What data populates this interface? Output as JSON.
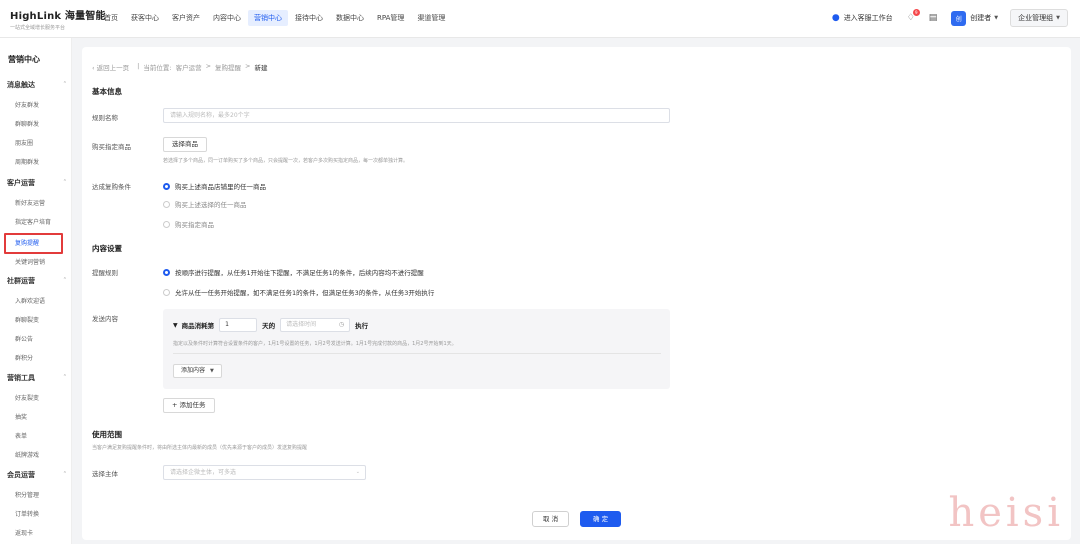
{
  "logo": {
    "title": "HighLink 海量智能",
    "subtitle": "一站式全域增长服务平台"
  },
  "nav": [
    "首页",
    "获客中心",
    "客户资产",
    "内容中心",
    "营销中心",
    "接待中心",
    "数据中心",
    "RPA管理",
    "渠道管理"
  ],
  "nav_active_index": 4,
  "topright": {
    "workspace_link": "进入客服工作台",
    "bell_badge": "9",
    "user_name": "创建者",
    "avatar_text": "创",
    "org_button": "企业管理组"
  },
  "sidebar": {
    "title": "营销中心",
    "groups": [
      {
        "label": "消息触达",
        "items": [
          "好友群发",
          "群聊群发",
          "朋友圈",
          "周期群发"
        ]
      },
      {
        "label": "客户运营",
        "items": [
          "新好友运营",
          "指定客户培育",
          "复购提醒",
          "关键词营销"
        ]
      },
      {
        "label": "社群运营",
        "items": [
          "入群欢迎语",
          "群聊裂变",
          "群公告",
          "群积分"
        ]
      },
      {
        "label": "营销工具",
        "items": [
          "好友裂变",
          "抽奖",
          "表单",
          "纸牌游戏"
        ]
      },
      {
        "label": "会员运营",
        "items": [
          "积分管理",
          "订单转换",
          "返现卡"
        ]
      }
    ],
    "active_item": "复购提醒"
  },
  "breadcrumb": {
    "back": "返回上一页",
    "prefix": "当前位置:",
    "p1": "客户运营",
    "p2": "复购提醒",
    "current": "新建"
  },
  "basic": {
    "title": "基本信息",
    "rule_name_label": "规则名称",
    "rule_name_placeholder": "请输入规则名称，最多20个字",
    "product_label": "购买指定商品",
    "select_product_btn": "选择商品",
    "product_hint": "若选择了多个商品，同一订单购买了多个商品，只会提醒一次，若客户多次购买指定商品，每一次都单独计算。",
    "condition_label": "达成复购条件",
    "conditions": [
      "购买上述商品店铺里的任一商品",
      "购买上述选择的任一商品",
      "购买指定商品"
    ]
  },
  "content": {
    "title": "内容设置",
    "rule_label": "提醒规则",
    "rules": [
      "按顺序进行提醒，从任务1开始往下提醒，不满足任务1的条件，后续内容均不进行提醒",
      "允许从任一任务开始提醒，如不满足任务1的条件，但满足任务3的条件，从任务3开始执行"
    ],
    "send_label": "发送内容",
    "task_prefix": "商品消耗第",
    "task_days": "1",
    "task_days_unit": "天的",
    "time_placeholder": "请选择时间",
    "task_suffix": "执行",
    "task_hint": "指定以及条件时计算符合设置条件的客户，1月1号设置的任务，1月2号发送计算。1月1号完成付款的商品，1月2号开始到1天。",
    "add_content_btn": "添加内容",
    "add_task_btn": "添加任务"
  },
  "scope": {
    "title": "使用范围",
    "hint": "当客户满足复购提醒条件时，将由所选主体内最新的成员（优先来源于客户的成员）发送复购提醒",
    "subject_label": "选择主体",
    "subject_placeholder": "请选择企微主体，可多选"
  },
  "footer": {
    "cancel": "取 消",
    "ok": "确 定"
  },
  "watermark": "heisi"
}
